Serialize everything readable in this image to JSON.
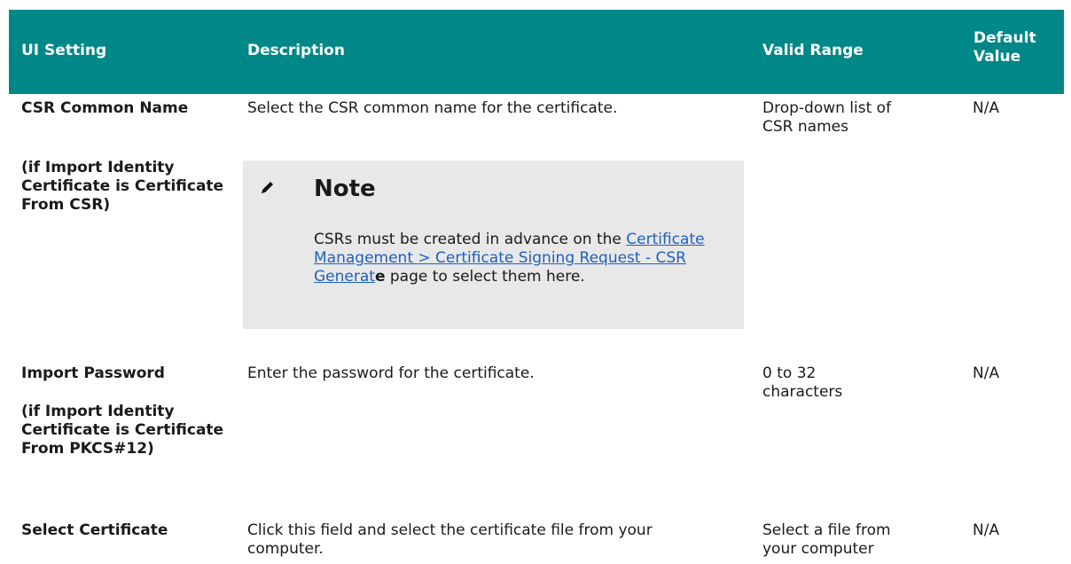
{
  "headers": {
    "ui_setting": "UI Setting",
    "description": "Description",
    "valid_range": "Valid Range",
    "default_value": "Default Value"
  },
  "rows": [
    {
      "ui_setting": "CSR Common Name",
      "condition": "(if Import Identity Certificate is Certificate From CSR)",
      "description": "Select the CSR common name for the certificate.",
      "valid_range": "Drop-down list of CSR names",
      "default_value": "N/A",
      "note": {
        "icon": "pencil-icon",
        "title": "Note",
        "text_before": "CSRs must be created in advance on the ",
        "link_text": "Certificate Management > Certificate Signing Request - CSR Generat",
        "link_bold_tail": "e",
        "text_after": " page to select them here."
      }
    },
    {
      "ui_setting": "Import Password",
      "condition": "(if Import Identity Certificate is Certificate From PKCS#12)",
      "description": "Enter the password for the certificate.",
      "valid_range": "0 to 32 characters",
      "default_value": "N/A"
    },
    {
      "ui_setting": "Select Certificate",
      "description": "Click this field and select the certificate file from your computer.",
      "valid_range": "Select a file from your computer",
      "default_value": "N/A"
    }
  ],
  "colors": {
    "header_bg": "#008787",
    "note_bg": "#e8e8e8",
    "link": "#1f5fbf"
  }
}
